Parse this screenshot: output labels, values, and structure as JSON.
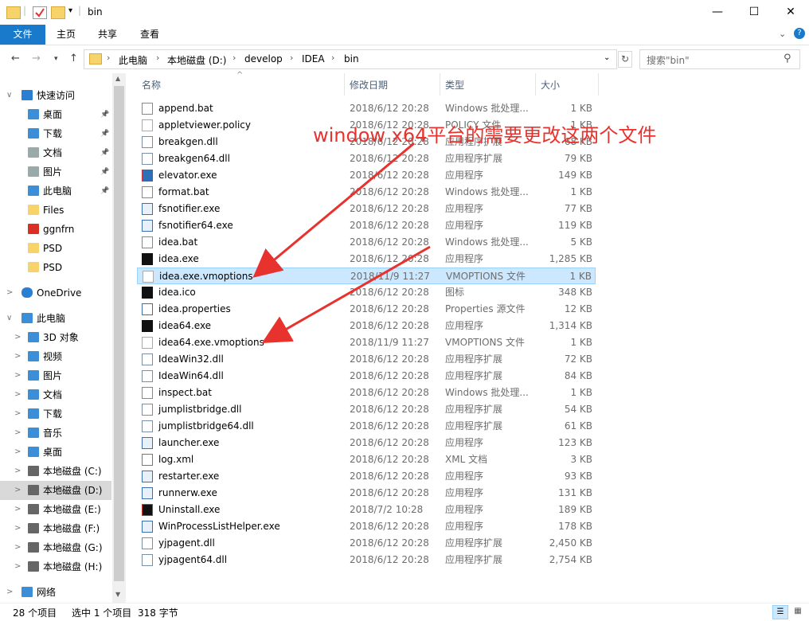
{
  "window": {
    "title": "bin"
  },
  "ribbon": {
    "tabs": [
      "文件",
      "主页",
      "共享",
      "查看"
    ]
  },
  "address": {
    "crumbs": [
      "此电脑",
      "本地磁盘 (D:)",
      "develop",
      "IDEA",
      "bin"
    ]
  },
  "search": {
    "placeholder": "搜索\"bin\""
  },
  "sidebar": {
    "quick_access": "快速访问",
    "quick_items": [
      "桌面",
      "下载",
      "文档",
      "图片",
      "此电脑",
      "Files",
      "ggnfrn",
      "PSD",
      "PSD"
    ],
    "onedrive": "OneDrive",
    "this_pc": "此电脑",
    "pc_items": [
      "3D 对象",
      "视频",
      "图片",
      "文档",
      "下载",
      "音乐",
      "桌面",
      "本地磁盘 (C:)",
      "本地磁盘 (D:)",
      "本地磁盘 (E:)",
      "本地磁盘 (F:)",
      "本地磁盘 (G:)",
      "本地磁盘 (H:)"
    ],
    "network": "网络"
  },
  "columns": {
    "name": "名称",
    "date": "修改日期",
    "type": "类型",
    "size": "大小"
  },
  "files": [
    {
      "name": "append.bat",
      "date": "2018/6/12 20:28",
      "type": "Windows 批处理...",
      "size": "1 KB",
      "icon": "bat"
    },
    {
      "name": "appletviewer.policy",
      "date": "2018/6/12 20:28",
      "type": "POLICY 文件",
      "size": "1 KB",
      "icon": "file"
    },
    {
      "name": "breakgen.dll",
      "date": "2018/6/12 20:28",
      "type": "应用程序扩展",
      "size": "68 KB",
      "icon": "dll"
    },
    {
      "name": "breakgen64.dll",
      "date": "2018/6/12 20:28",
      "type": "应用程序扩展",
      "size": "79 KB",
      "icon": "dll"
    },
    {
      "name": "elevator.exe",
      "date": "2018/6/12 20:28",
      "type": "应用程序",
      "size": "149 KB",
      "icon": "shield"
    },
    {
      "name": "format.bat",
      "date": "2018/6/12 20:28",
      "type": "Windows 批处理...",
      "size": "1 KB",
      "icon": "bat"
    },
    {
      "name": "fsnotifier.exe",
      "date": "2018/6/12 20:28",
      "type": "应用程序",
      "size": "77 KB",
      "icon": "exe"
    },
    {
      "name": "fsnotifier64.exe",
      "date": "2018/6/12 20:28",
      "type": "应用程序",
      "size": "119 KB",
      "icon": "exe"
    },
    {
      "name": "idea.bat",
      "date": "2018/6/12 20:28",
      "type": "Windows 批处理...",
      "size": "5 KB",
      "icon": "bat"
    },
    {
      "name": "idea.exe",
      "date": "2018/6/12 20:28",
      "type": "应用程序",
      "size": "1,285 KB",
      "icon": "ij"
    },
    {
      "name": "idea.exe.vmoptions",
      "date": "2018/11/9 11:27",
      "type": "VMOPTIONS 文件",
      "size": "1 KB",
      "icon": "file",
      "selected": true
    },
    {
      "name": "idea.ico",
      "date": "2018/6/12 20:28",
      "type": "图标",
      "size": "348 KB",
      "icon": "ij"
    },
    {
      "name": "idea.properties",
      "date": "2018/6/12 20:28",
      "type": "Properties 源文件",
      "size": "12 KB",
      "icon": "prop"
    },
    {
      "name": "idea64.exe",
      "date": "2018/6/12 20:28",
      "type": "应用程序",
      "size": "1,314 KB",
      "icon": "ij"
    },
    {
      "name": "idea64.exe.vmoptions",
      "date": "2018/11/9 11:27",
      "type": "VMOPTIONS 文件",
      "size": "1 KB",
      "icon": "file"
    },
    {
      "name": "IdeaWin32.dll",
      "date": "2018/6/12 20:28",
      "type": "应用程序扩展",
      "size": "72 KB",
      "icon": "dll"
    },
    {
      "name": "IdeaWin64.dll",
      "date": "2018/6/12 20:28",
      "type": "应用程序扩展",
      "size": "84 KB",
      "icon": "dll"
    },
    {
      "name": "inspect.bat",
      "date": "2018/6/12 20:28",
      "type": "Windows 批处理...",
      "size": "1 KB",
      "icon": "bat"
    },
    {
      "name": "jumplistbridge.dll",
      "date": "2018/6/12 20:28",
      "type": "应用程序扩展",
      "size": "54 KB",
      "icon": "dll"
    },
    {
      "name": "jumplistbridge64.dll",
      "date": "2018/6/12 20:28",
      "type": "应用程序扩展",
      "size": "61 KB",
      "icon": "dll"
    },
    {
      "name": "launcher.exe",
      "date": "2018/6/12 20:28",
      "type": "应用程序",
      "size": "123 KB",
      "icon": "exe"
    },
    {
      "name": "log.xml",
      "date": "2018/6/12 20:28",
      "type": "XML 文档",
      "size": "3 KB",
      "icon": "xml"
    },
    {
      "name": "restarter.exe",
      "date": "2018/6/12 20:28",
      "type": "应用程序",
      "size": "93 KB",
      "icon": "exe"
    },
    {
      "name": "runnerw.exe",
      "date": "2018/6/12 20:28",
      "type": "应用程序",
      "size": "131 KB",
      "icon": "exe"
    },
    {
      "name": "Uninstall.exe",
      "date": "2018/7/2 10:28",
      "type": "应用程序",
      "size": "189 KB",
      "icon": "uninst"
    },
    {
      "name": "WinProcessListHelper.exe",
      "date": "2018/6/12 20:28",
      "type": "应用程序",
      "size": "178 KB",
      "icon": "exe"
    },
    {
      "name": "yjpagent.dll",
      "date": "2018/6/12 20:28",
      "type": "应用程序扩展",
      "size": "2,450 KB",
      "icon": "dll"
    },
    {
      "name": "yjpagent64.dll",
      "date": "2018/6/12 20:28",
      "type": "应用程序扩展",
      "size": "2,754 KB",
      "icon": "dll"
    }
  ],
  "status": {
    "count": "28 个项目",
    "selection": "选中 1 个项目",
    "size": "318 字节"
  },
  "annotation": "window x64平台的需要更改这两个文件",
  "colors": {
    "accent": "#1979ca",
    "selection": "#cce8ff",
    "annotation": "#e8322d"
  }
}
